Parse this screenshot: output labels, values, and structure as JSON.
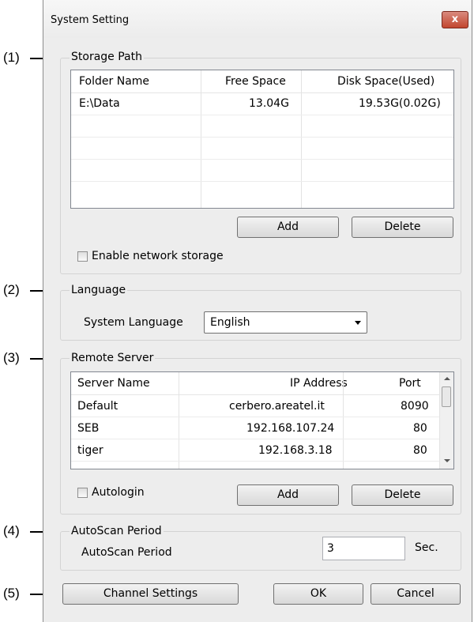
{
  "window": {
    "title": "System Setting",
    "close_symbol": "x"
  },
  "callouts": [
    "(1)",
    "(2)",
    "(3)",
    "(4)",
    "(5)"
  ],
  "storage": {
    "label": "Storage Path",
    "columns": [
      "Folder Name",
      "Free Space",
      "Disk Space(Used)"
    ],
    "rows": [
      {
        "folder": "E:\\Data",
        "free": "13.04G",
        "disk": "19.53G(0.02G)"
      }
    ],
    "add_label": "Add",
    "delete_label": "Delete",
    "network_label": "Enable network storage"
  },
  "language": {
    "label": "Language",
    "field_label": "System Language",
    "selected": "English"
  },
  "remote": {
    "label": "Remote Server",
    "columns": [
      "Server Name",
      "IP Address",
      "Port"
    ],
    "rows": [
      {
        "name": "Default",
        "ip": "cerbero.areatel.it",
        "port": "8090"
      },
      {
        "name": "SEB",
        "ip": "192.168.107.24",
        "port": "80"
      },
      {
        "name": "tiger",
        "ip": "192.168.3.18",
        "port": "80"
      }
    ],
    "autologin_label": "Autologin",
    "add_label": "Add",
    "delete_label": "Delete"
  },
  "autoscan": {
    "label": "AutoScan Period",
    "field_label": "AutoScan Period",
    "value": "3",
    "unit": "Sec."
  },
  "footer": {
    "channel_label": "Channel Settings",
    "ok_label": "OK",
    "cancel_label": "Cancel"
  }
}
